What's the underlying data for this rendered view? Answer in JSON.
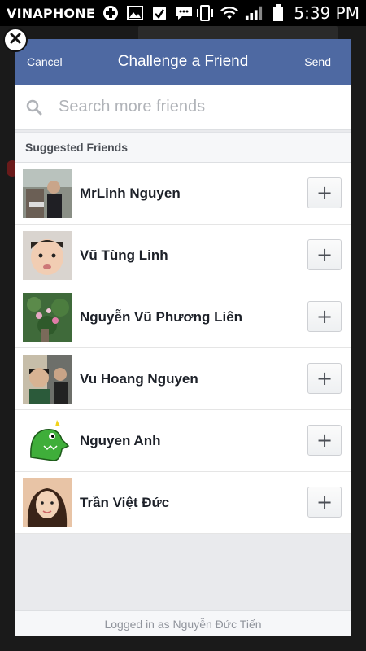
{
  "status_bar": {
    "carrier": "VINAPHONE",
    "time": "5:39 PM",
    "icons": [
      "medical-cross-icon",
      "image-icon",
      "task-check-icon",
      "message-icon",
      "vibrate-icon",
      "wifi-icon",
      "signal-icon",
      "battery-icon"
    ]
  },
  "dialog": {
    "cancel_label": "Cancel",
    "title": "Challenge a Friend",
    "send_label": "Send",
    "search_placeholder": "Search more friends",
    "section_title": "Suggested Friends",
    "friends": [
      {
        "name": "MrLinh Nguyen"
      },
      {
        "name": "Vũ Tùng Linh"
      },
      {
        "name": "Nguyễn Vũ Phương Liên"
      },
      {
        "name": "Vu Hoang Nguyen"
      },
      {
        "name": "Nguyen Anh"
      },
      {
        "name": "Trần Việt Đức"
      }
    ],
    "add_label": "+",
    "footer": "Logged in as Nguyễn Đức Tiến"
  },
  "colors": {
    "header": "#4e69a2",
    "accent_text": "#ffffff",
    "list_bg": "#ffffff",
    "dialog_bg": "#e9eaed"
  }
}
